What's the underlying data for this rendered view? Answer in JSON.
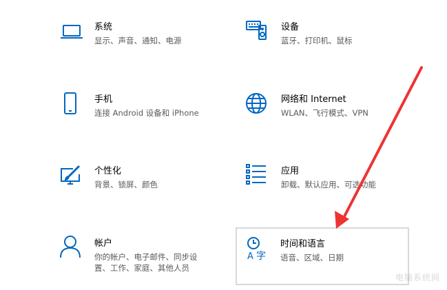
{
  "accent_color": "#0067c0",
  "arrow_color": "#ee3333",
  "tiles": [
    {
      "id": "system",
      "icon": "laptop-icon",
      "title": "系统",
      "desc": "显示、声音、通知、电源"
    },
    {
      "id": "devices",
      "icon": "keyboard-speaker-icon",
      "title": "设备",
      "desc": "蓝牙、打印机、鼠标"
    },
    {
      "id": "phone",
      "icon": "phone-icon",
      "title": "手机",
      "desc": "连接 Android 设备和 iPhone"
    },
    {
      "id": "network",
      "icon": "globe-icon",
      "title": "网络和 Internet",
      "desc": "WLAN、飞行模式、VPN"
    },
    {
      "id": "personalization",
      "icon": "paint-brush-monitor-icon",
      "title": "个性化",
      "desc": "背景、锁屏、颜色"
    },
    {
      "id": "apps",
      "icon": "app-list-icon",
      "title": "应用",
      "desc": "卸载、默认应用、可选功能"
    },
    {
      "id": "accounts",
      "icon": "person-icon",
      "title": "帐户",
      "desc": "你的帐户、电子邮件、同步设置、工作、家庭、其他人员",
      "desc_line1": "你的帐户、电子邮件、同步设",
      "desc_line2": "置、工作、家庭、其他人员"
    },
    {
      "id": "time-language",
      "icon": "clock-language-icon",
      "title": "时间和语言",
      "desc": "语音、区域、日期"
    }
  ],
  "watermark": "电脑系统网"
}
